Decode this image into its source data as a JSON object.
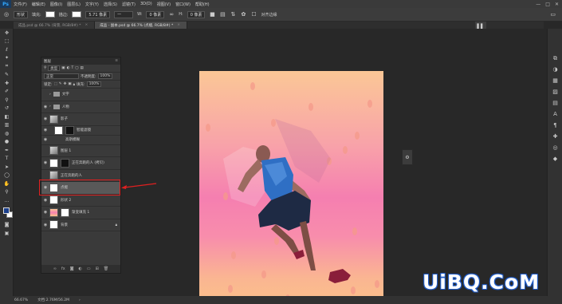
{
  "app": {
    "logo": "Ps"
  },
  "menubar": {
    "items": [
      "文件(F)",
      "编辑(E)",
      "图像(I)",
      "图层(L)",
      "文字(Y)",
      "选择(S)",
      "滤镜(T)",
      "3D(D)",
      "视图(V)",
      "窗口(W)",
      "帮助(H)"
    ],
    "window_controls": [
      "—",
      "□",
      "✕"
    ]
  },
  "options": {
    "mode": "形状",
    "fill_label": "填充:",
    "stroke_label": "描边:",
    "stroke_width": "5.71 像素",
    "w_label": "W:",
    "w_value": "0 像素",
    "h_label": "H:",
    "h_value": "0 像素",
    "align_edges": "对齐边缘"
  },
  "tabs": [
    {
      "label": "成品.psd @ 66.7% (背景, RGB/8#) *",
      "active": false
    },
    {
      "label": "成品 - 副本.psd @ 66.7% (点缀, RGB/8#) *",
      "active": true
    }
  ],
  "layers_panel": {
    "title": "图层",
    "kind_filter": "类型",
    "blend_mode": "正常",
    "opacity_label": "不透明度:",
    "opacity_value": "100%",
    "lock_label": "锁定:",
    "fill_label": "填充:",
    "fill_value": "100%",
    "layers": [
      {
        "name": "文字",
        "type": "group",
        "visible": false
      },
      {
        "name": "人物",
        "type": "group",
        "visible": true
      },
      {
        "name": "影子",
        "type": "smart",
        "visible": true
      },
      {
        "name": "智能滤镜",
        "type": "filter",
        "visible": true
      },
      {
        "name": "高斯模糊",
        "type": "filter-item",
        "visible": true
      },
      {
        "name": "图层 1",
        "type": "layer",
        "visible": false
      },
      {
        "name": "正在奔跑的人 (拷贝)",
        "type": "layer",
        "visible": true
      },
      {
        "name": "正在奔跑的人",
        "type": "layer",
        "visible": false
      },
      {
        "name": "点缀",
        "type": "layer",
        "visible": true,
        "selected": true
      },
      {
        "name": "形状 2",
        "type": "shape",
        "visible": true
      },
      {
        "name": "渐变填充 1",
        "type": "fill",
        "visible": true
      },
      {
        "name": "背景",
        "type": "background",
        "visible": true
      }
    ]
  },
  "status": {
    "zoom": "66.67%",
    "doc": "文档:2.76M/56.2M"
  },
  "watermark": "UiBQ.CoM",
  "colors": {
    "foreground": "#1b3f8b",
    "background": "#ffffff",
    "highlight": "#e02020"
  }
}
